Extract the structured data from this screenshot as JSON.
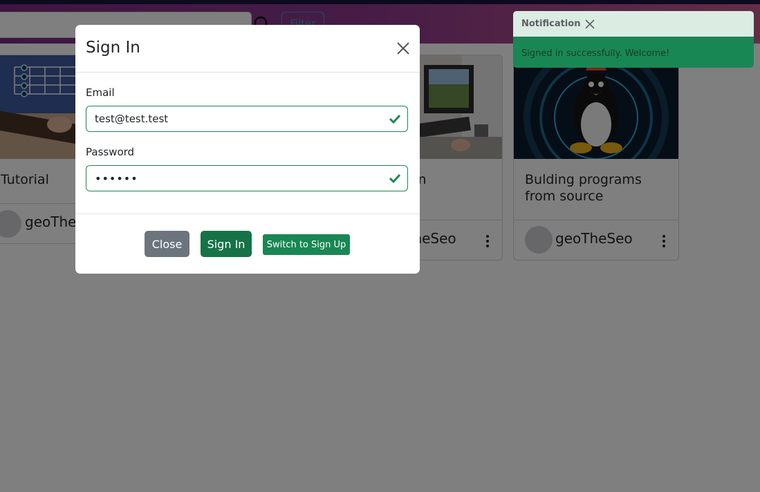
{
  "navbar": {
    "filter_label": "Filter",
    "search_icon": "search-icon"
  },
  "cards": [
    {
      "title": "Tutorial",
      "author": "geoTheSeo",
      "icon": "kebab-menu-icon"
    },
    {
      "title": "& Friends in",
      "author": "geoTheSeo",
      "icon": "kebab-menu-icon"
    },
    {
      "title": "Bulding programs from source",
      "author": "geoTheSeo",
      "icon": "kebab-menu-icon"
    }
  ],
  "modal": {
    "title": "Sign In",
    "email_label": "Email",
    "email_value": "test@test.test",
    "password_label": "Password",
    "password_value": "secret",
    "close_label": "Close",
    "signin_label": "Sign In",
    "switch_label": "Switch to Sign Up"
  },
  "toast": {
    "title": "Notification",
    "message": "Signed in successfully. Welcome!"
  },
  "colors": {
    "success": "#198754",
    "secondary": "#6c757d",
    "toast_header": "#dbece3"
  }
}
